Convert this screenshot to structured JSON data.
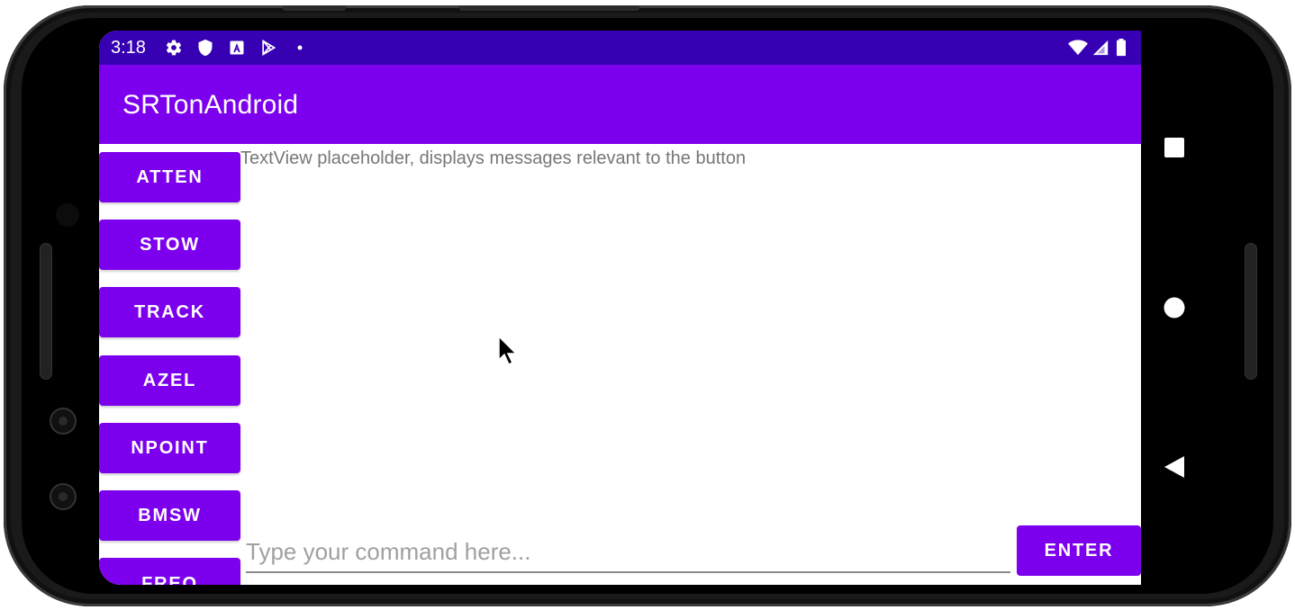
{
  "status_bar": {
    "time": "3:18",
    "left_icons": [
      "gear-icon",
      "shield-icon",
      "a-box-icon",
      "play-store-icon",
      "dot-icon"
    ],
    "right_icons": [
      "wifi-icon",
      "signal-icon",
      "battery-icon"
    ],
    "background": "#3700b3"
  },
  "app_bar": {
    "title": "SRTonAndroid",
    "background": "#7c00ee"
  },
  "command_buttons": [
    {
      "label": "ATTEN"
    },
    {
      "label": "STOW"
    },
    {
      "label": "TRACK"
    },
    {
      "label": "AZEL"
    },
    {
      "label": "NPOINT"
    },
    {
      "label": "BMSW"
    },
    {
      "label": "FREQ"
    }
  ],
  "text_view": {
    "text": "TextView placeholder, displays messages relevant to the button"
  },
  "command_input": {
    "value": "",
    "placeholder": "Type your command here..."
  },
  "enter_button": {
    "label": "ENTER"
  },
  "nav_bar": {
    "icons": [
      "recents-square-icon",
      "home-circle-icon",
      "back-triangle-icon"
    ]
  },
  "colors": {
    "accent": "#7c00ee",
    "status": "#3700b3"
  }
}
